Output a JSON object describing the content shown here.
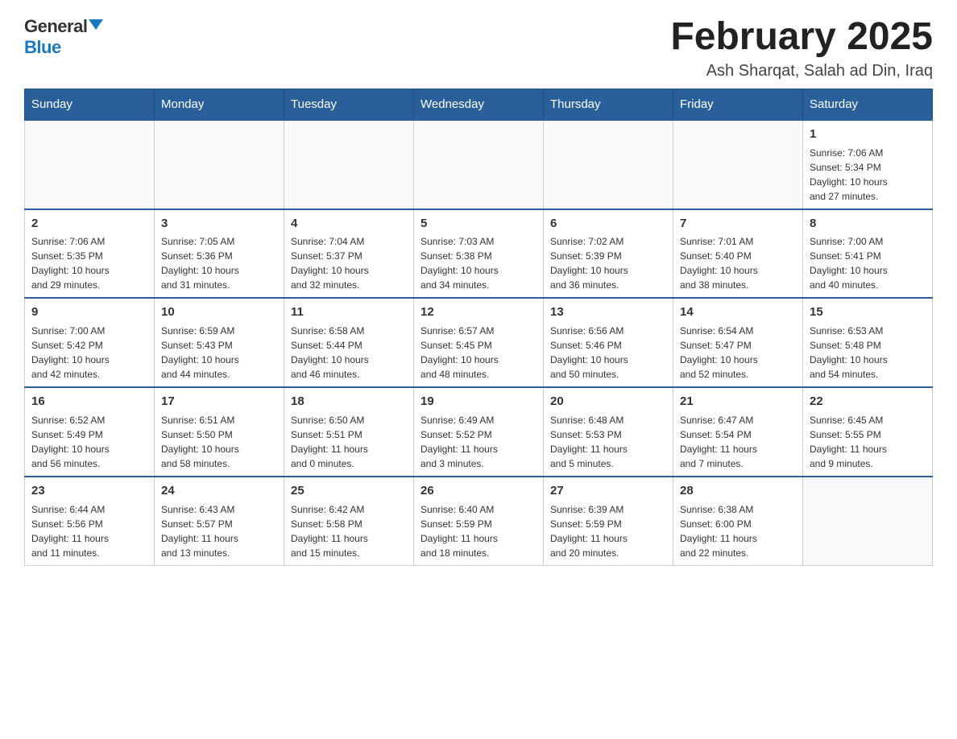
{
  "header": {
    "logo": {
      "general": "General",
      "blue": "Blue"
    },
    "title": "February 2025",
    "location": "Ash Sharqat, Salah ad Din, Iraq"
  },
  "days_of_week": [
    "Sunday",
    "Monday",
    "Tuesday",
    "Wednesday",
    "Thursday",
    "Friday",
    "Saturday"
  ],
  "weeks": [
    {
      "days": [
        {
          "date": "",
          "info": ""
        },
        {
          "date": "",
          "info": ""
        },
        {
          "date": "",
          "info": ""
        },
        {
          "date": "",
          "info": ""
        },
        {
          "date": "",
          "info": ""
        },
        {
          "date": "",
          "info": ""
        },
        {
          "date": "1",
          "info": "Sunrise: 7:06 AM\nSunset: 5:34 PM\nDaylight: 10 hours\nand 27 minutes."
        }
      ]
    },
    {
      "days": [
        {
          "date": "2",
          "info": "Sunrise: 7:06 AM\nSunset: 5:35 PM\nDaylight: 10 hours\nand 29 minutes."
        },
        {
          "date": "3",
          "info": "Sunrise: 7:05 AM\nSunset: 5:36 PM\nDaylight: 10 hours\nand 31 minutes."
        },
        {
          "date": "4",
          "info": "Sunrise: 7:04 AM\nSunset: 5:37 PM\nDaylight: 10 hours\nand 32 minutes."
        },
        {
          "date": "5",
          "info": "Sunrise: 7:03 AM\nSunset: 5:38 PM\nDaylight: 10 hours\nand 34 minutes."
        },
        {
          "date": "6",
          "info": "Sunrise: 7:02 AM\nSunset: 5:39 PM\nDaylight: 10 hours\nand 36 minutes."
        },
        {
          "date": "7",
          "info": "Sunrise: 7:01 AM\nSunset: 5:40 PM\nDaylight: 10 hours\nand 38 minutes."
        },
        {
          "date": "8",
          "info": "Sunrise: 7:00 AM\nSunset: 5:41 PM\nDaylight: 10 hours\nand 40 minutes."
        }
      ]
    },
    {
      "days": [
        {
          "date": "9",
          "info": "Sunrise: 7:00 AM\nSunset: 5:42 PM\nDaylight: 10 hours\nand 42 minutes."
        },
        {
          "date": "10",
          "info": "Sunrise: 6:59 AM\nSunset: 5:43 PM\nDaylight: 10 hours\nand 44 minutes."
        },
        {
          "date": "11",
          "info": "Sunrise: 6:58 AM\nSunset: 5:44 PM\nDaylight: 10 hours\nand 46 minutes."
        },
        {
          "date": "12",
          "info": "Sunrise: 6:57 AM\nSunset: 5:45 PM\nDaylight: 10 hours\nand 48 minutes."
        },
        {
          "date": "13",
          "info": "Sunrise: 6:56 AM\nSunset: 5:46 PM\nDaylight: 10 hours\nand 50 minutes."
        },
        {
          "date": "14",
          "info": "Sunrise: 6:54 AM\nSunset: 5:47 PM\nDaylight: 10 hours\nand 52 minutes."
        },
        {
          "date": "15",
          "info": "Sunrise: 6:53 AM\nSunset: 5:48 PM\nDaylight: 10 hours\nand 54 minutes."
        }
      ]
    },
    {
      "days": [
        {
          "date": "16",
          "info": "Sunrise: 6:52 AM\nSunset: 5:49 PM\nDaylight: 10 hours\nand 56 minutes."
        },
        {
          "date": "17",
          "info": "Sunrise: 6:51 AM\nSunset: 5:50 PM\nDaylight: 10 hours\nand 58 minutes."
        },
        {
          "date": "18",
          "info": "Sunrise: 6:50 AM\nSunset: 5:51 PM\nDaylight: 11 hours\nand 0 minutes."
        },
        {
          "date": "19",
          "info": "Sunrise: 6:49 AM\nSunset: 5:52 PM\nDaylight: 11 hours\nand 3 minutes."
        },
        {
          "date": "20",
          "info": "Sunrise: 6:48 AM\nSunset: 5:53 PM\nDaylight: 11 hours\nand 5 minutes."
        },
        {
          "date": "21",
          "info": "Sunrise: 6:47 AM\nSunset: 5:54 PM\nDaylight: 11 hours\nand 7 minutes."
        },
        {
          "date": "22",
          "info": "Sunrise: 6:45 AM\nSunset: 5:55 PM\nDaylight: 11 hours\nand 9 minutes."
        }
      ]
    },
    {
      "days": [
        {
          "date": "23",
          "info": "Sunrise: 6:44 AM\nSunset: 5:56 PM\nDaylight: 11 hours\nand 11 minutes."
        },
        {
          "date": "24",
          "info": "Sunrise: 6:43 AM\nSunset: 5:57 PM\nDaylight: 11 hours\nand 13 minutes."
        },
        {
          "date": "25",
          "info": "Sunrise: 6:42 AM\nSunset: 5:58 PM\nDaylight: 11 hours\nand 15 minutes."
        },
        {
          "date": "26",
          "info": "Sunrise: 6:40 AM\nSunset: 5:59 PM\nDaylight: 11 hours\nand 18 minutes."
        },
        {
          "date": "27",
          "info": "Sunrise: 6:39 AM\nSunset: 5:59 PM\nDaylight: 11 hours\nand 20 minutes."
        },
        {
          "date": "28",
          "info": "Sunrise: 6:38 AM\nSunset: 6:00 PM\nDaylight: 11 hours\nand 22 minutes."
        },
        {
          "date": "",
          "info": ""
        }
      ]
    }
  ]
}
